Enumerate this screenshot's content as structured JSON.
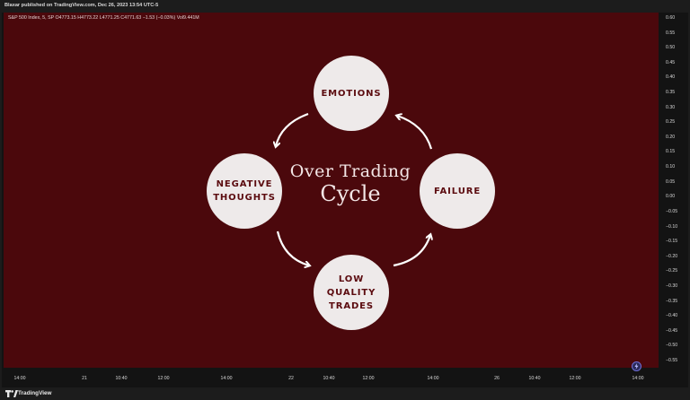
{
  "header": {
    "publish_info": "Blaxar published on TradingView.com, Dec 26, 2023 13:54 UTC-5"
  },
  "symbol_line": "S&P 500 Index, 5, SP  O4773.15  H4773.22  L4771.25  C4771.63  −1.53 (−0.03%)  Vol9.441M",
  "price_axis": [
    "0.60",
    "0.55",
    "0.50",
    "0.45",
    "0.40",
    "0.35",
    "0.30",
    "0.25",
    "0.20",
    "0.15",
    "0.10",
    "0.05",
    "0.00",
    "−0.05",
    "−0.10",
    "−0.15",
    "−0.20",
    "−0.25",
    "−0.30",
    "−0.35",
    "−0.40",
    "−0.45",
    "−0.50",
    "−0.55"
  ],
  "time_axis": [
    "14:00",
    "21",
    "10:40",
    "12:00",
    "14:00",
    "22",
    "10:40",
    "12:00",
    "14:00",
    "26",
    "10:40",
    "12:00",
    "14:00"
  ],
  "cycle": {
    "title_line1": "Over Trading",
    "title_line2": "Cycle",
    "emotions": "EMOTIONS",
    "negative_line1": "NEGATIVE",
    "negative_line2": "THOUGHTS",
    "failure": "FAILURE",
    "low_line1": "LOW QUALITY",
    "low_line2": "TRADES"
  },
  "footer": {
    "brand": "TradingView"
  },
  "icons": {
    "logo": "tradingview-logo-icon",
    "lightning": "lightning-icon"
  },
  "colors": {
    "pane_bg": "#4b080c",
    "node_bg": "#eeeaea",
    "node_text": "#5b0b0f"
  }
}
